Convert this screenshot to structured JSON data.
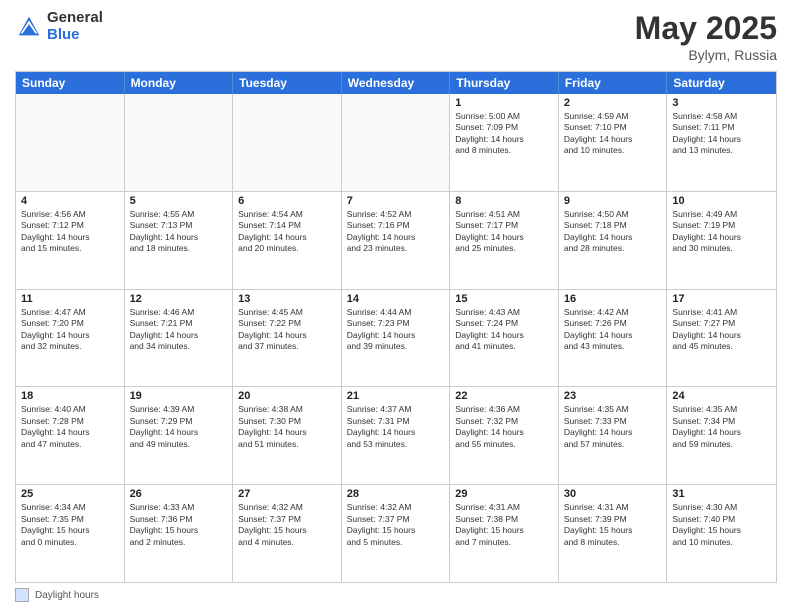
{
  "header": {
    "logo_general": "General",
    "logo_blue": "Blue",
    "title_month": "May 2025",
    "title_location": "Bylym, Russia"
  },
  "footer": {
    "label": "Daylight hours"
  },
  "calendar": {
    "weekdays": [
      "Sunday",
      "Monday",
      "Tuesday",
      "Wednesday",
      "Thursday",
      "Friday",
      "Saturday"
    ],
    "rows": [
      [
        {
          "day": "",
          "info": ""
        },
        {
          "day": "",
          "info": ""
        },
        {
          "day": "",
          "info": ""
        },
        {
          "day": "",
          "info": ""
        },
        {
          "day": "1",
          "info": "Sunrise: 5:00 AM\nSunset: 7:09 PM\nDaylight: 14 hours\nand 8 minutes."
        },
        {
          "day": "2",
          "info": "Sunrise: 4:59 AM\nSunset: 7:10 PM\nDaylight: 14 hours\nand 10 minutes."
        },
        {
          "day": "3",
          "info": "Sunrise: 4:58 AM\nSunset: 7:11 PM\nDaylight: 14 hours\nand 13 minutes."
        }
      ],
      [
        {
          "day": "4",
          "info": "Sunrise: 4:56 AM\nSunset: 7:12 PM\nDaylight: 14 hours\nand 15 minutes."
        },
        {
          "day": "5",
          "info": "Sunrise: 4:55 AM\nSunset: 7:13 PM\nDaylight: 14 hours\nand 18 minutes."
        },
        {
          "day": "6",
          "info": "Sunrise: 4:54 AM\nSunset: 7:14 PM\nDaylight: 14 hours\nand 20 minutes."
        },
        {
          "day": "7",
          "info": "Sunrise: 4:52 AM\nSunset: 7:16 PM\nDaylight: 14 hours\nand 23 minutes."
        },
        {
          "day": "8",
          "info": "Sunrise: 4:51 AM\nSunset: 7:17 PM\nDaylight: 14 hours\nand 25 minutes."
        },
        {
          "day": "9",
          "info": "Sunrise: 4:50 AM\nSunset: 7:18 PM\nDaylight: 14 hours\nand 28 minutes."
        },
        {
          "day": "10",
          "info": "Sunrise: 4:49 AM\nSunset: 7:19 PM\nDaylight: 14 hours\nand 30 minutes."
        }
      ],
      [
        {
          "day": "11",
          "info": "Sunrise: 4:47 AM\nSunset: 7:20 PM\nDaylight: 14 hours\nand 32 minutes."
        },
        {
          "day": "12",
          "info": "Sunrise: 4:46 AM\nSunset: 7:21 PM\nDaylight: 14 hours\nand 34 minutes."
        },
        {
          "day": "13",
          "info": "Sunrise: 4:45 AM\nSunset: 7:22 PM\nDaylight: 14 hours\nand 37 minutes."
        },
        {
          "day": "14",
          "info": "Sunrise: 4:44 AM\nSunset: 7:23 PM\nDaylight: 14 hours\nand 39 minutes."
        },
        {
          "day": "15",
          "info": "Sunrise: 4:43 AM\nSunset: 7:24 PM\nDaylight: 14 hours\nand 41 minutes."
        },
        {
          "day": "16",
          "info": "Sunrise: 4:42 AM\nSunset: 7:26 PM\nDaylight: 14 hours\nand 43 minutes."
        },
        {
          "day": "17",
          "info": "Sunrise: 4:41 AM\nSunset: 7:27 PM\nDaylight: 14 hours\nand 45 minutes."
        }
      ],
      [
        {
          "day": "18",
          "info": "Sunrise: 4:40 AM\nSunset: 7:28 PM\nDaylight: 14 hours\nand 47 minutes."
        },
        {
          "day": "19",
          "info": "Sunrise: 4:39 AM\nSunset: 7:29 PM\nDaylight: 14 hours\nand 49 minutes."
        },
        {
          "day": "20",
          "info": "Sunrise: 4:38 AM\nSunset: 7:30 PM\nDaylight: 14 hours\nand 51 minutes."
        },
        {
          "day": "21",
          "info": "Sunrise: 4:37 AM\nSunset: 7:31 PM\nDaylight: 14 hours\nand 53 minutes."
        },
        {
          "day": "22",
          "info": "Sunrise: 4:36 AM\nSunset: 7:32 PM\nDaylight: 14 hours\nand 55 minutes."
        },
        {
          "day": "23",
          "info": "Sunrise: 4:35 AM\nSunset: 7:33 PM\nDaylight: 14 hours\nand 57 minutes."
        },
        {
          "day": "24",
          "info": "Sunrise: 4:35 AM\nSunset: 7:34 PM\nDaylight: 14 hours\nand 59 minutes."
        }
      ],
      [
        {
          "day": "25",
          "info": "Sunrise: 4:34 AM\nSunset: 7:35 PM\nDaylight: 15 hours\nand 0 minutes."
        },
        {
          "day": "26",
          "info": "Sunrise: 4:33 AM\nSunset: 7:36 PM\nDaylight: 15 hours\nand 2 minutes."
        },
        {
          "day": "27",
          "info": "Sunrise: 4:32 AM\nSunset: 7:37 PM\nDaylight: 15 hours\nand 4 minutes."
        },
        {
          "day": "28",
          "info": "Sunrise: 4:32 AM\nSunset: 7:37 PM\nDaylight: 15 hours\nand 5 minutes."
        },
        {
          "day": "29",
          "info": "Sunrise: 4:31 AM\nSunset: 7:38 PM\nDaylight: 15 hours\nand 7 minutes."
        },
        {
          "day": "30",
          "info": "Sunrise: 4:31 AM\nSunset: 7:39 PM\nDaylight: 15 hours\nand 8 minutes."
        },
        {
          "day": "31",
          "info": "Sunrise: 4:30 AM\nSunset: 7:40 PM\nDaylight: 15 hours\nand 10 minutes."
        }
      ]
    ]
  }
}
